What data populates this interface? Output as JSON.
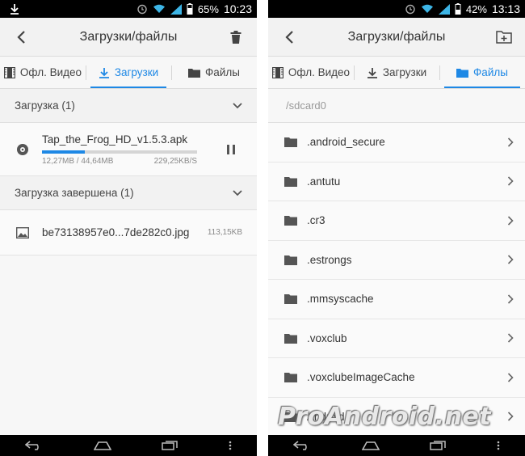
{
  "watermark": "ProAndroid.net",
  "left": {
    "status": {
      "battery": "65%",
      "time": "10:23"
    },
    "appbar": {
      "title": "Загрузки/файлы",
      "back_icon": "chevron-left-icon",
      "action_icon": "trash-icon"
    },
    "tabs": [
      {
        "label": "Офл. Видео",
        "icon": "film-icon",
        "active": false
      },
      {
        "label": "Загрузки",
        "icon": "download-icon",
        "active": true
      },
      {
        "label": "Файлы",
        "icon": "folder-icon",
        "active": false
      }
    ],
    "active_section": {
      "label": "Загрузка (1)"
    },
    "active_item": {
      "name": "Tap_the_Frog_HD_v1.5.3.apk",
      "downloaded": "12,27MB / 44,64MB",
      "speed": "229,25KB/S",
      "progress": 0.275
    },
    "done_section": {
      "label": "Загрузка завершена (1)"
    },
    "done_item": {
      "name": "be73138957e0...7de282c0.jpg",
      "size": "113,15KB"
    }
  },
  "right": {
    "status": {
      "battery": "42%",
      "time": "13:13"
    },
    "appbar": {
      "title": "Загрузки/файлы",
      "back_icon": "chevron-left-icon",
      "action_icon": "new-folder-icon"
    },
    "tabs": [
      {
        "label": "Офл. Видео",
        "icon": "film-icon",
        "active": false
      },
      {
        "label": "Загрузки",
        "icon": "download-icon",
        "active": false
      },
      {
        "label": "Файлы",
        "icon": "folder-icon",
        "active": true
      }
    ],
    "path": "/sdcard0",
    "folders": [
      ".android_secure",
      ".antutu",
      ".cr3",
      ".estrongs",
      ".mmsyscache",
      ".voxclub",
      ".voxclubeImageCache",
      "Android"
    ]
  },
  "colors": {
    "accent": "#1e88e5",
    "statusbar": "#000000",
    "status_icon": "#3db5e6"
  }
}
